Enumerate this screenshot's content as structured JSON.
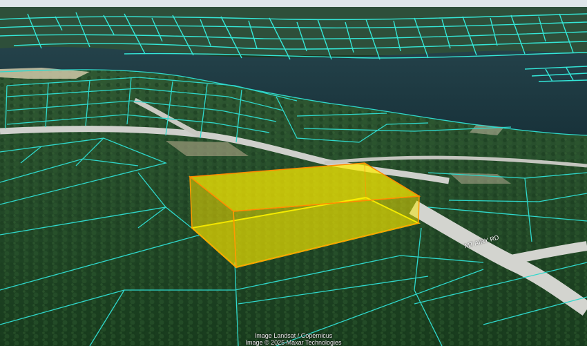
{
  "map": {
    "view": "3d-oblique-satellite",
    "layers": [
      "satellite-imagery",
      "parcel-boundaries",
      "highlight-box"
    ],
    "road_label": "MT AIRY RD"
  },
  "attribution": {
    "line1": "Image Landsat / Copernicus",
    "line2": "Image © 2025 Maxar Technologies"
  },
  "colors": {
    "sky": "#dfe6ea",
    "water": "#1f3b42",
    "forest": "#224a26",
    "parcel_line": "#35f0e0",
    "road": "#cfd0cc",
    "highlight_fill": "#f4e800",
    "highlight_edge": "#ff8a00"
  }
}
